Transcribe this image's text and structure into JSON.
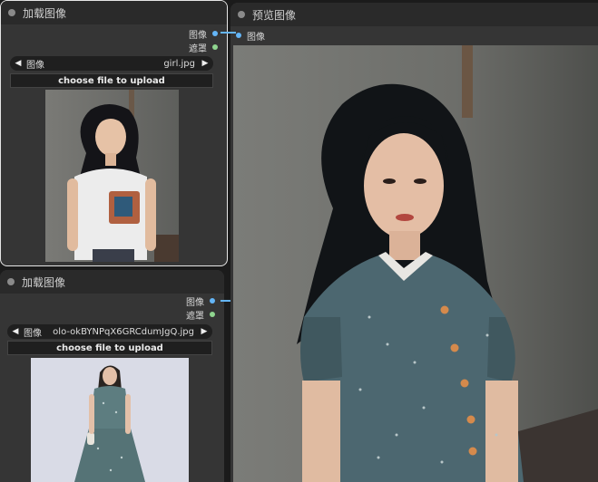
{
  "node1": {
    "title": "加载图像",
    "outputs": {
      "image": "图像",
      "mask": "遮罩"
    },
    "combo": {
      "prev": "◀",
      "label": "图像",
      "value": "girl.jpg",
      "next": "▶"
    },
    "upload_label": "choose file to upload"
  },
  "node2": {
    "title": "加载图像",
    "outputs": {
      "image": "图像",
      "mask": "遮罩"
    },
    "combo": {
      "prev": "◀",
      "label": "图像",
      "value": "olo-okBYNPqX6GRCdumJgQ.jpg",
      "next": "▶"
    },
    "upload_label": "choose file to upload"
  },
  "preview": {
    "title": "预览图像",
    "input_label": "图像"
  },
  "colors": {
    "canvas": "#1b1b1b",
    "node_body": "#353535",
    "node_header": "#2a2a2a",
    "image_port": "#64b5f6",
    "mask_port": "#8fd58f"
  }
}
